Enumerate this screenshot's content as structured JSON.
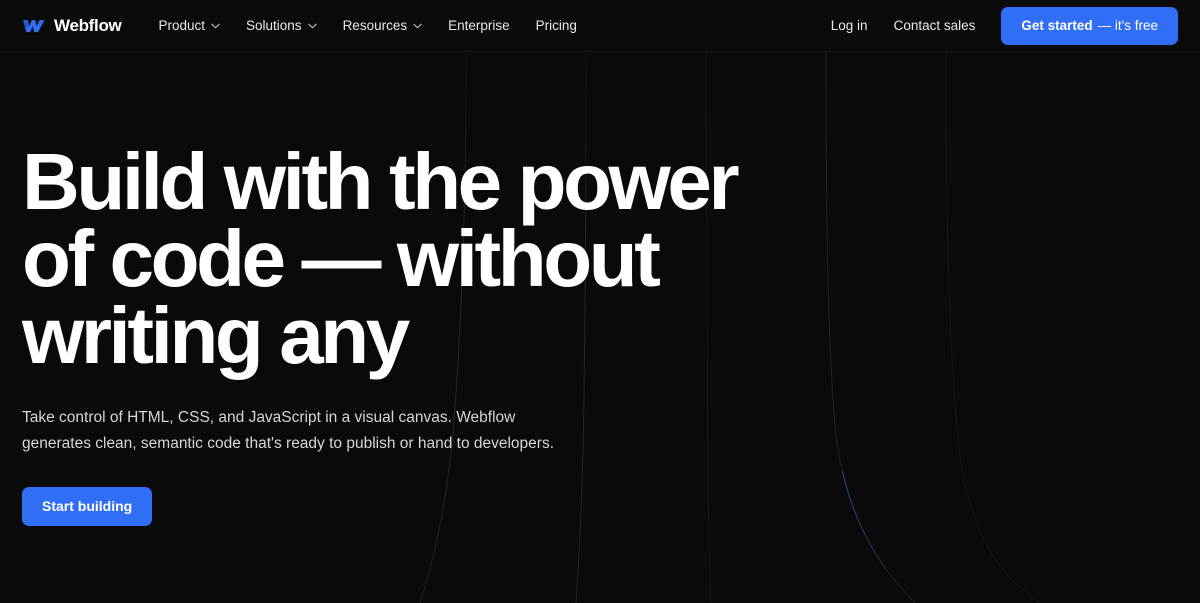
{
  "colors": {
    "page_background": "#0a0a0a",
    "nav_background": "#0b0b0c",
    "accent_blue": "#2f6ef5",
    "text_primary": "#ffffff",
    "text_secondary": "#d6d6d9",
    "strand_faint": "#232326",
    "strand_glow": "#1e3f9e"
  },
  "nav": {
    "brand": {
      "logo_icon": "webflow-w-logo-icon",
      "name": "Webflow"
    },
    "links": [
      {
        "label": "Product",
        "has_dropdown": true,
        "icon": "chevron-down-icon"
      },
      {
        "label": "Solutions",
        "has_dropdown": true,
        "icon": "chevron-down-icon"
      },
      {
        "label": "Resources",
        "has_dropdown": true,
        "icon": "chevron-down-icon"
      },
      {
        "label": "Enterprise",
        "has_dropdown": false
      },
      {
        "label": "Pricing",
        "has_dropdown": false
      }
    ],
    "actions": [
      {
        "label": "Log in"
      },
      {
        "label": "Contact sales"
      }
    ],
    "cta": {
      "strong_label": "Get started",
      "light_label": "— it's free"
    }
  },
  "hero": {
    "headline_lines": [
      "Build with the power",
      "of code — without",
      "writing any"
    ],
    "subcopy_lines": [
      "Take control of HTML, CSS, and JavaScript in a visual canvas. Webflow",
      "generates clean, semantic code that's ready to publish or hand to developers."
    ],
    "button_label": "Start building"
  }
}
